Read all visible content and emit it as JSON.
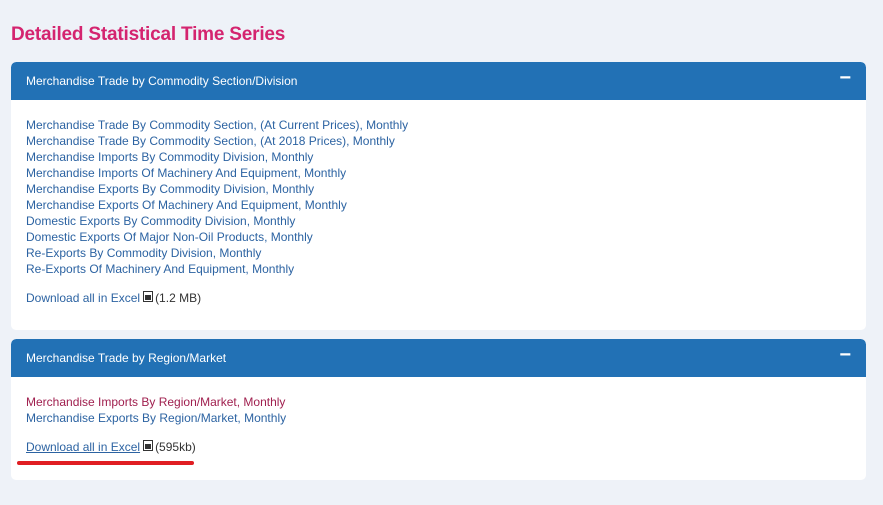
{
  "page_title": "Detailed Statistical Time Series",
  "sections": [
    {
      "title": "Merchandise Trade by Commodity Section/Division",
      "collapse_glyph": "−",
      "links": [
        "Merchandise Trade By Commodity Section, (At Current Prices), Monthly",
        "Merchandise Trade By Commodity Section, (At 2018 Prices), Monthly",
        "Merchandise Imports By Commodity Division, Monthly",
        "Merchandise Imports Of Machinery And Equipment, Monthly",
        "Merchandise Exports By Commodity Division, Monthly",
        "Merchandise Exports Of Machinery And Equipment, Monthly",
        "Domestic Exports By Commodity Division, Monthly",
        "Domestic Exports Of Major Non-Oil Products, Monthly",
        "Re-Exports By Commodity Division, Monthly",
        "Re-Exports Of Machinery And Equipment, Monthly"
      ],
      "download_label": "Download all in Excel",
      "download_size": "(1.2 MB)"
    },
    {
      "title": "Merchandise Trade by Region/Market",
      "collapse_glyph": "−",
      "links": [
        "Merchandise Imports By Region/Market, Monthly",
        "Merchandise Exports By Region/Market, Monthly"
      ],
      "download_label": "Download all in Excel",
      "download_size": "(595kb)"
    }
  ],
  "colors": {
    "title": "#d4246f",
    "header": "#2271b5",
    "link": "#2c63a2",
    "visited_link": "#a0204f",
    "annotation": "#e01d22",
    "background": "#eef2f8"
  },
  "icons": {
    "excel": "excel-file-icon",
    "collapse": "minus-icon"
  }
}
